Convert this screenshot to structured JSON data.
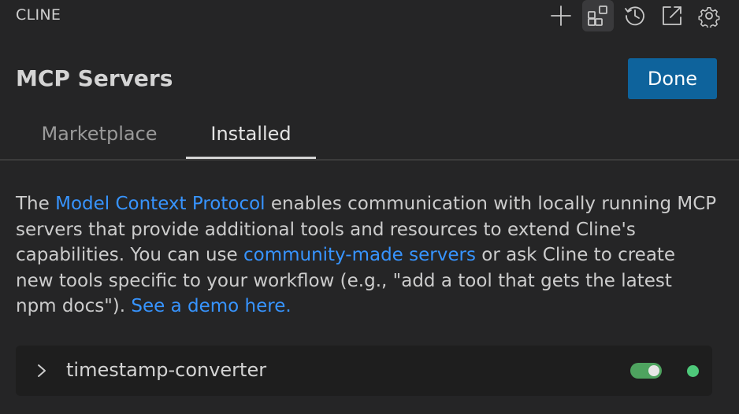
{
  "header": {
    "title": "CLINE",
    "actions": [
      {
        "icon": "plus-icon",
        "label": "New Task"
      },
      {
        "icon": "mcp-servers-icon",
        "label": "MCP Servers"
      },
      {
        "icon": "history-icon",
        "label": "History"
      },
      {
        "icon": "external-link-icon",
        "label": "Open in Editor"
      },
      {
        "icon": "gear-icon",
        "label": "Settings"
      }
    ]
  },
  "view": {
    "title": "MCP Servers",
    "done_label": "Done"
  },
  "tabs": [
    {
      "label": "Marketplace",
      "active": false
    },
    {
      "label": "Installed",
      "active": true
    }
  ],
  "description": {
    "part1": "The ",
    "link1": "Model Context Protocol",
    "part2": " enables communication with locally running MCP servers that provide additional tools and resources to extend Cline's capabilities. You can use ",
    "link2": "community-made servers",
    "part3": " or ask Cline to create new tools specific to your workflow (e.g., \"add a tool that gets the latest npm docs\"). ",
    "link3": "See a demo here."
  },
  "servers": [
    {
      "name": "timestamp-converter",
      "enabled": true,
      "status": "connected"
    }
  ],
  "colors": {
    "accent": "#0e639c",
    "link": "#3794ff",
    "status_connected": "#4ec97a",
    "toggle_on": "#4ea35f"
  }
}
